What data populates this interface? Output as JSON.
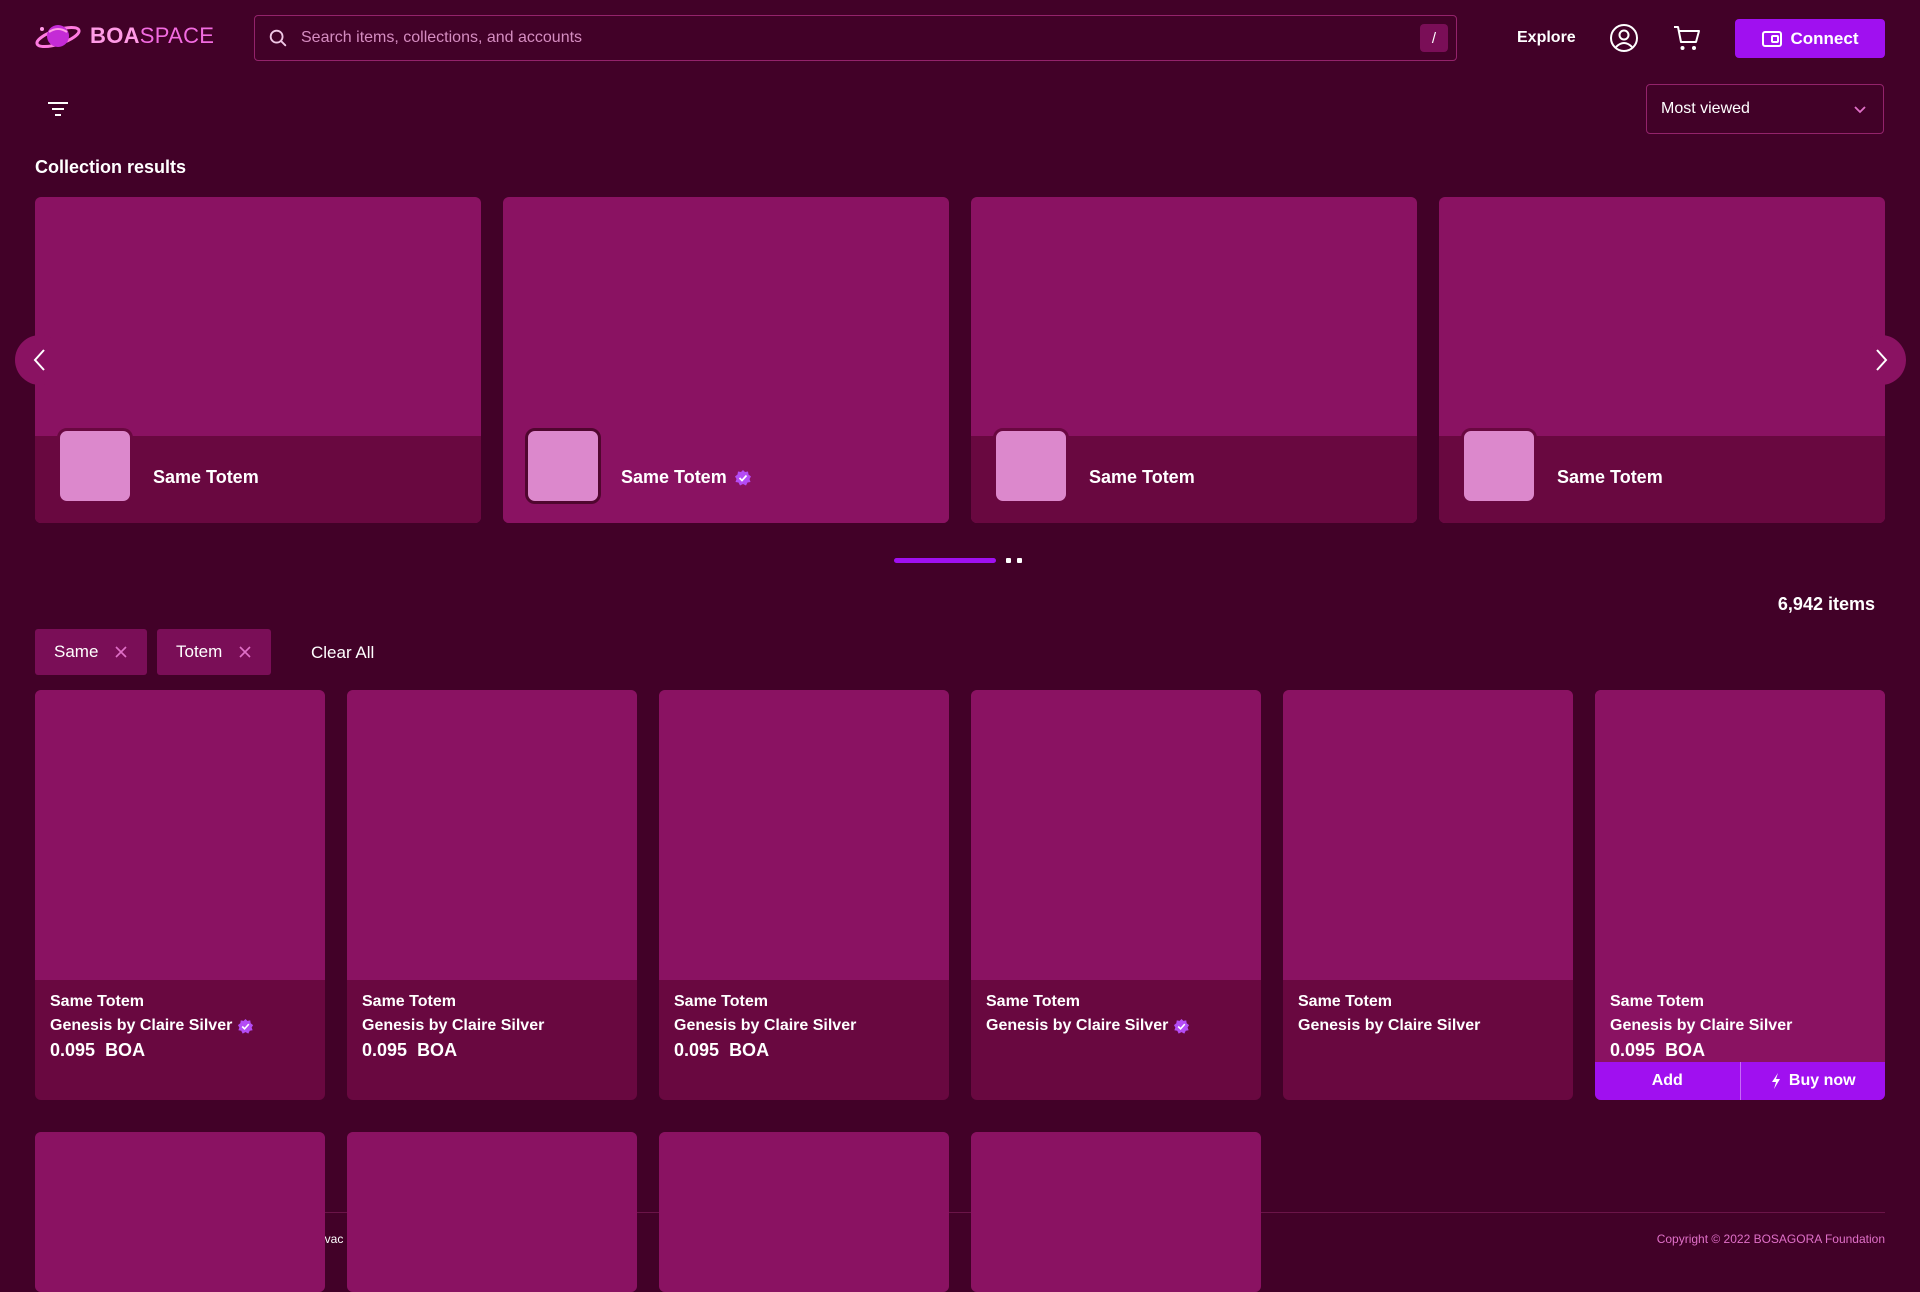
{
  "header": {
    "logo_bold": "BOA",
    "logo_light": "SPACE",
    "search_placeholder": "Search items, collections, and accounts",
    "search_shortcut": "/",
    "explore_label": "Explore",
    "connect_label": "Connect"
  },
  "toolbar": {
    "sort_selected": "Most viewed"
  },
  "collections": {
    "title": "Collection results",
    "items": [
      {
        "name": "Same Totem",
        "verified": false
      },
      {
        "name": "Same Totem",
        "verified": true
      },
      {
        "name": "Same Totem",
        "verified": false
      },
      {
        "name": "Same Totem",
        "verified": false
      }
    ],
    "pagination_pages": 3,
    "pagination_current": 1
  },
  "results": {
    "count_label": "6,942 items",
    "filters": [
      "Same",
      "Totem"
    ],
    "clear_label": "Clear All"
  },
  "items": [
    {
      "title": "Same Totem",
      "collection": "Genesis by Claire Silver",
      "verified": true,
      "price": "0.095",
      "currency": "BOA"
    },
    {
      "title": "Same Totem",
      "collection": "Genesis by Claire Silver",
      "verified": false,
      "price": "0.095",
      "currency": "BOA"
    },
    {
      "title": "Same Totem",
      "collection": "Genesis by Claire Silver",
      "verified": false,
      "price": "0.095",
      "currency": "BOA"
    },
    {
      "title": "Same Totem",
      "collection": "Genesis by Claire Silver",
      "verified": true,
      "price": "",
      "currency": ""
    },
    {
      "title": "Same Totem",
      "collection": "Genesis by Claire Silver",
      "verified": false,
      "price": "",
      "currency": ""
    },
    {
      "title": "Same Totem",
      "collection": "Genesis by Claire Silver",
      "verified": false,
      "price": "0.095",
      "currency": "BOA",
      "add_label": "Add",
      "buy_label": "Buy now"
    }
  ],
  "footer": {
    "privacy_fragment": "ivac",
    "copyright": "Copyright © 2022 BOSAGORA Foundation"
  },
  "colors": {
    "background": "#420128",
    "card": "#8a1262",
    "card_footer": "#690840",
    "accent": "#a010f0",
    "verified": "#b44cf5"
  }
}
